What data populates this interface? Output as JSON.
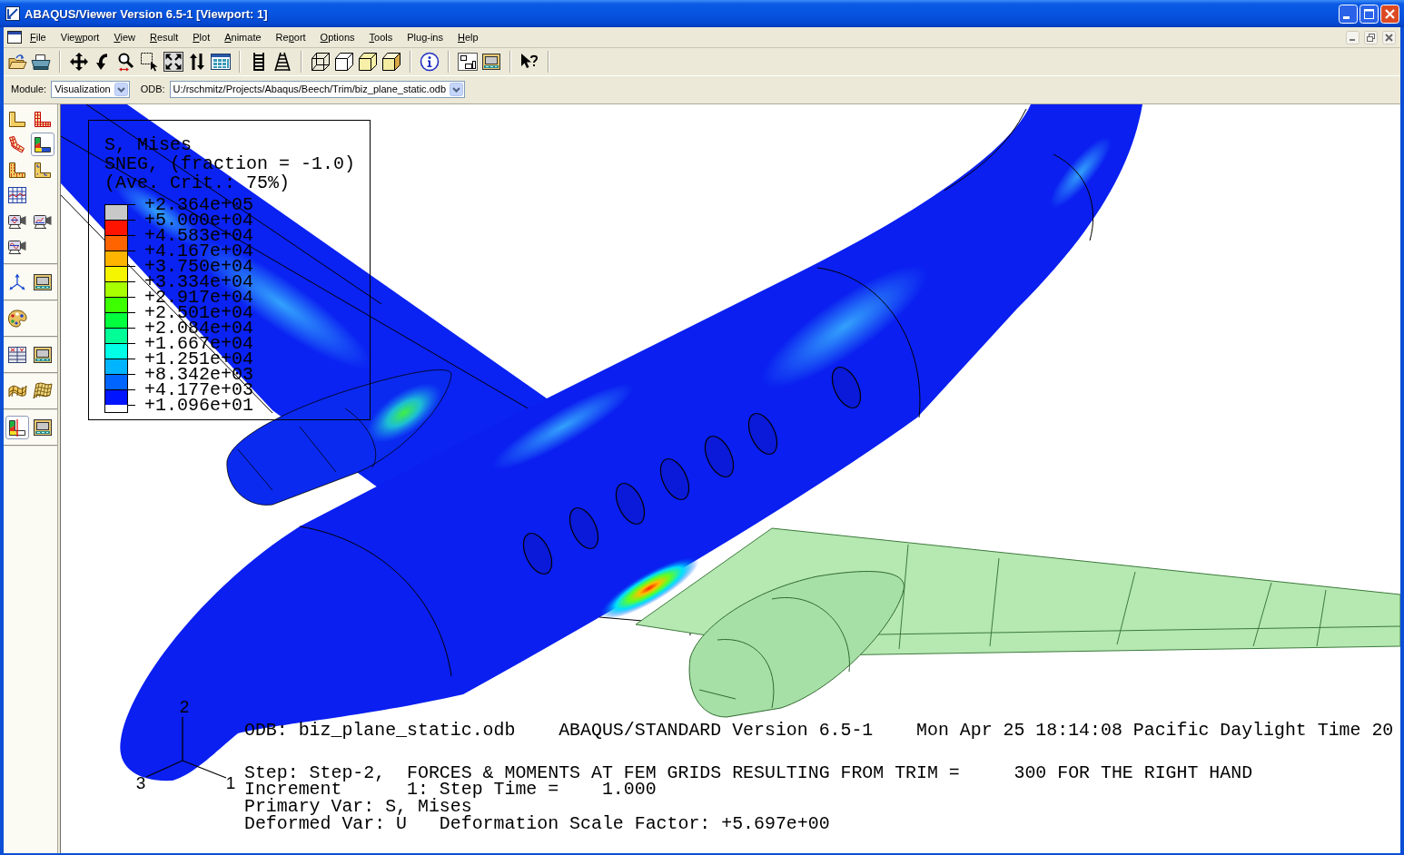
{
  "window": {
    "title": "ABAQUS/Viewer Version 6.5-1 [Viewport: 1]"
  },
  "menu": [
    {
      "key": "F",
      "post": "ile"
    },
    {
      "pre": "Vie",
      "key": "w",
      "post": "port"
    },
    {
      "key": "V",
      "post": "iew"
    },
    {
      "key": "R",
      "post": "esult"
    },
    {
      "key": "P",
      "post": "lot"
    },
    {
      "key": "A",
      "post": "nimate"
    },
    {
      "pre": "Re",
      "key": "p",
      "post": "ort"
    },
    {
      "key": "O",
      "post": "ptions"
    },
    {
      "key": "T",
      "post": "ools"
    },
    {
      "pre": "Plu",
      "key": "g",
      "post": "-ins"
    },
    {
      "key": "H",
      "post": "elp"
    }
  ],
  "context_bar": {
    "module_label": "Module:",
    "module": "Visualization",
    "odb_label": "ODB:",
    "odb": "U:/rschmitz/Projects/Abaqus/Beech/Trim/biz_plane_static.odb"
  },
  "toolbox": [
    {
      "rows": [
        [
          {
            "kind": "undeformed",
            "selected": false
          },
          {
            "kind": "deformed",
            "selected": false
          }
        ],
        [
          {
            "kind": "bent",
            "selected": false
          },
          {
            "kind": "contour",
            "selected": true
          }
        ],
        [
          {
            "kind": "symbol",
            "selected": false
          },
          {
            "kind": "orientation",
            "selected": false
          }
        ],
        [
          {
            "kind": "xyplot",
            "selected": false
          }
        ],
        [
          {
            "kind": "scale",
            "selected": false
          },
          {
            "kind": "harmonic",
            "selected": false
          }
        ],
        [
          {
            "kind": "timehistory",
            "selected": false
          }
        ]
      ]
    },
    {
      "rows": [
        [
          {
            "kind": "triad",
            "selected": false
          },
          {
            "kind": "panel",
            "selected": false
          }
        ]
      ]
    },
    {
      "rows": [
        [
          {
            "kind": "palette",
            "selected": false
          }
        ]
      ]
    },
    {
      "rows": [
        [
          {
            "kind": "xydata",
            "selected": false
          },
          {
            "kind": "panel",
            "selected": false
          }
        ]
      ]
    },
    {
      "rows": [
        [
          {
            "kind": "surface",
            "selected": false
          },
          {
            "kind": "mesh",
            "selected": false
          }
        ]
      ]
    },
    {
      "rows": [
        [
          {
            "kind": "cut",
            "selected": true
          },
          {
            "kind": "panel",
            "selected": false
          }
        ]
      ]
    }
  ],
  "viewport": {
    "legend": {
      "heading": [
        "S, Mises",
        "SNEG, (fraction = -1.0)",
        "(Ave. Crit.: 75%)"
      ],
      "bands": [
        {
          "color": "#c8c8c8"
        },
        {
          "color": "#ff1400"
        },
        {
          "color": "#ff6400"
        },
        {
          "color": "#ffb400"
        },
        {
          "color": "#f5f500"
        },
        {
          "color": "#a8ff00"
        },
        {
          "color": "#3cff00"
        },
        {
          "color": "#00ff3c"
        },
        {
          "color": "#00ff96"
        },
        {
          "color": "#00ffe6"
        },
        {
          "color": "#00b4ff"
        },
        {
          "color": "#0064ff"
        },
        {
          "color": "#0014ff"
        }
      ],
      "values": [
        "+2.364e+05",
        "+5.000e+04",
        "+4.583e+04",
        "+4.167e+04",
        "+3.750e+04",
        "+3.334e+04",
        "+2.917e+04",
        "+2.501e+04",
        "+2.084e+04",
        "+1.667e+04",
        "+1.251e+04",
        "+8.342e+03",
        "+4.177e+03",
        "+1.096e+01"
      ]
    },
    "triad_labels": [
      "1",
      "2",
      "3"
    ],
    "title_line": "ODB: biz_plane_static.odb    ABAQUS/STANDARD Version 6.5-1    Mon Apr 25 18:14:08 Pacific Daylight Time 20",
    "state_lines": [
      "Step: Step-2,  FORCES & MOMENTS AT FEM GRIDS RESULTING FROM TRIM =     300 FOR THE RIGHT HAND",
      "Increment      1: Step Time =    1.000",
      "Primary Var: S, Mises",
      "Deformed Var: U   Deformation Scale Factor: +5.697e+00"
    ]
  }
}
